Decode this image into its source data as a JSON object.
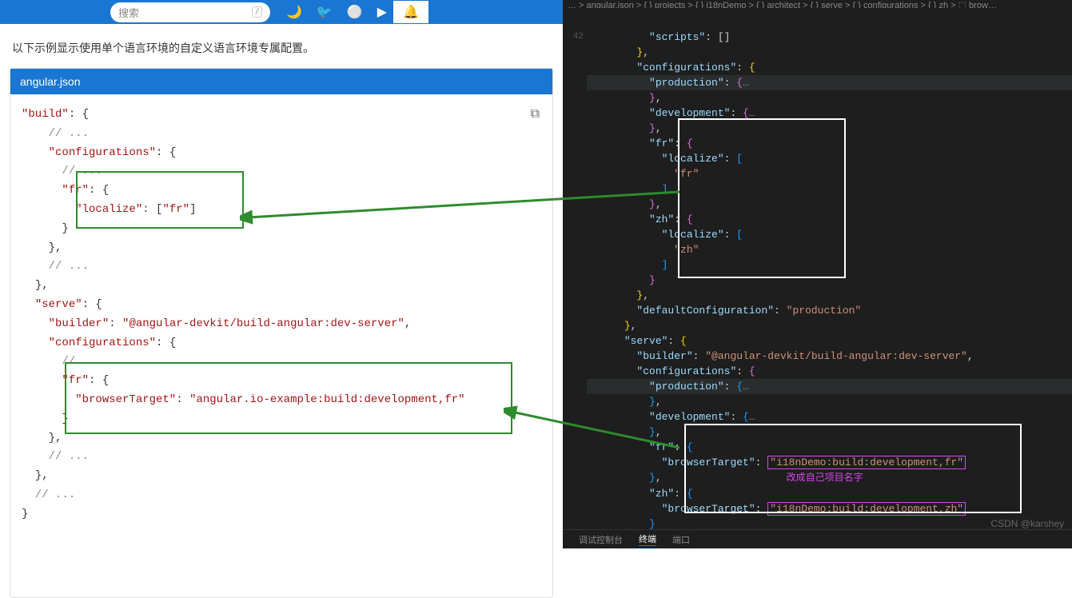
{
  "topbar": {
    "search_placeholder": "搜索",
    "slash": "/"
  },
  "description": "以下示例显示使用单个语言环境的自定义语言环境专属配置。",
  "code_card": {
    "filename": "angular.json",
    "build_key": "\"build\"",
    "configurations_key": "\"configurations\"",
    "fr_key": "\"fr\"",
    "localize_key": "\"localize\"",
    "fr_val": "\"fr\"",
    "serve_key": "\"serve\"",
    "builder_key": "\"builder\"",
    "builder_val": "\"@angular-devkit/build-angular:dev-server\"",
    "browserTarget_key": "\"browserTarget\"",
    "browserTarget_val": "\"angular.io-example:build:development,fr\"",
    "comment": "// ..."
  },
  "editor": {
    "breadcrumb": "… > angular.json > { } projects > { } i18nDemo > { } architect > { } serve > { } configurations > { } zh > ⬚ brow…",
    "line_num": "42",
    "scripts_key": "\"scripts\"",
    "configurations_key": "\"configurations\"",
    "production_key": "\"production\"",
    "development_key": "\"development\"",
    "fr_key": "\"fr\"",
    "zh_key": "\"zh\"",
    "localize_key": "\"localize\"",
    "fr_val": "\"fr\"",
    "zh_val": "\"zh\"",
    "defaultConfiguration_key": "\"defaultConfiguration\"",
    "production_val": "\"production\"",
    "serve_key": "\"serve\"",
    "builder_key": "\"builder\"",
    "builder_val": "\"@angular-devkit/build-angular:dev-server\"",
    "browserTarget_key": "\"browserTarget\"",
    "i18nDemo_fr": "\"i18nDemo:build:development,fr\"",
    "i18nDemo_zh": "\"i18nDemo:build:development,zh\"",
    "magenta_note": "改成自己项目名字"
  },
  "bottom_tabs": {
    "debug": "调试控制台",
    "terminal": "终端",
    "port": "端口"
  },
  "watermark": "CSDN @karshey"
}
